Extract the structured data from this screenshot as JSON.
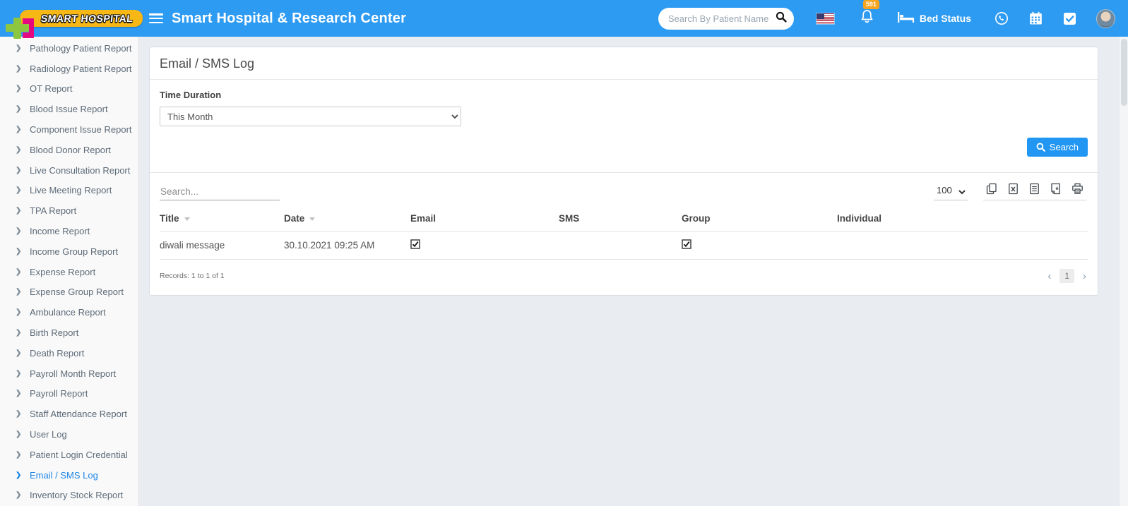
{
  "header": {
    "logo_text": "SMART HOSPITAL",
    "title": "Smart Hospital & Research Center",
    "search_placeholder": "Search By Patient Name",
    "notification_count": "591",
    "bed_status_label": "Bed Status",
    "icons": [
      "hamburger-icon",
      "search-icon",
      "us-flag-icon",
      "bell-icon",
      "bed-icon",
      "whatsapp-icon",
      "calendar-icon",
      "tasks-icon",
      "avatar"
    ]
  },
  "sidebar": {
    "items": [
      {
        "label": "Pathology Patient Report",
        "active": false
      },
      {
        "label": "Radiology Patient Report",
        "active": false
      },
      {
        "label": "OT Report",
        "active": false
      },
      {
        "label": "Blood Issue Report",
        "active": false
      },
      {
        "label": "Component Issue Report",
        "active": false
      },
      {
        "label": "Blood Donor Report",
        "active": false
      },
      {
        "label": "Live Consultation Report",
        "active": false
      },
      {
        "label": "Live Meeting Report",
        "active": false
      },
      {
        "label": "TPA Report",
        "active": false
      },
      {
        "label": "Income Report",
        "active": false
      },
      {
        "label": "Income Group Report",
        "active": false
      },
      {
        "label": "Expense Report",
        "active": false
      },
      {
        "label": "Expense Group Report",
        "active": false
      },
      {
        "label": "Ambulance Report",
        "active": false
      },
      {
        "label": "Birth Report",
        "active": false
      },
      {
        "label": "Death Report",
        "active": false
      },
      {
        "label": "Payroll Month Report",
        "active": false
      },
      {
        "label": "Payroll Report",
        "active": false
      },
      {
        "label": "Staff Attendance Report",
        "active": false
      },
      {
        "label": "User Log",
        "active": false
      },
      {
        "label": "Patient Login Credential",
        "active": false
      },
      {
        "label": "Email / SMS Log",
        "active": true
      },
      {
        "label": "Inventory Stock Report",
        "active": false
      }
    ]
  },
  "page": {
    "title": "Email / SMS Log",
    "filter_label": "Time Duration",
    "filter_selected": "This Month",
    "search_button_label": "Search"
  },
  "table": {
    "search_placeholder": "Search...",
    "page_size": "100",
    "export_icons": [
      "copy-icon",
      "excel-icon",
      "text-file-icon",
      "pdf-icon",
      "print-icon"
    ],
    "columns": [
      {
        "label": "Title",
        "sortable": true
      },
      {
        "label": "Date",
        "sortable": true
      },
      {
        "label": "Email",
        "sortable": false
      },
      {
        "label": "SMS",
        "sortable": false
      },
      {
        "label": "Group",
        "sortable": false
      },
      {
        "label": "Individual",
        "sortable": false
      }
    ],
    "rows": [
      {
        "title": "diwali message",
        "date": "30.10.2021 09:25 AM",
        "email": true,
        "sms": false,
        "group": true,
        "individual": false
      }
    ],
    "records_text": "Records: 1 to 1 of 1",
    "pagination": {
      "prev": "‹",
      "current_page": "1",
      "next": "›"
    }
  },
  "colors": {
    "header_blue": "#2e9bf3",
    "accent_blue": "#2196f3",
    "active_link": "#1d86e8",
    "badge_orange": "#f8a41c",
    "logo_yellow": "#f7b715",
    "logo_green": "#8dc63f",
    "logo_pink": "#e5097f",
    "main_bg": "#e9edf2",
    "sidebar_bg": "#f9f9f9"
  }
}
